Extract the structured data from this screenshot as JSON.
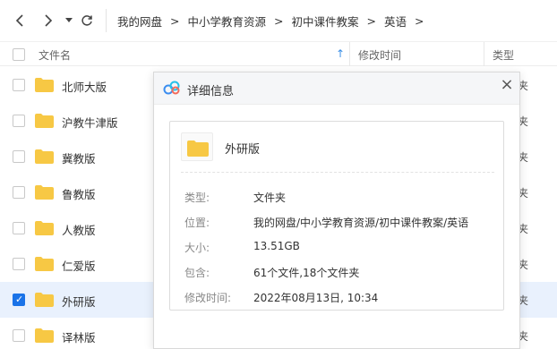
{
  "breadcrumb": [
    "我的网盘",
    "中小学教育资源",
    "初中课件教案",
    "英语"
  ],
  "breadcrumb_separator": ">",
  "columns": {
    "name": "文件名",
    "mtime": "修改时间",
    "type": "类型"
  },
  "rows": [
    {
      "name": "北师大版",
      "type_partial": "夹",
      "selected": false
    },
    {
      "name": "沪教牛津版",
      "type_partial": "夹",
      "selected": false
    },
    {
      "name": "冀教版",
      "type_partial": "夹",
      "selected": false
    },
    {
      "name": "鲁教版",
      "type_partial": "夹",
      "selected": false
    },
    {
      "name": "人教版",
      "type_partial": "夹",
      "selected": false
    },
    {
      "name": "仁爱版",
      "type_partial": "夹",
      "selected": false
    },
    {
      "name": "外研版",
      "type_partial": "夹",
      "selected": true
    },
    {
      "name": "译林版",
      "type_partial": "夹",
      "selected": false
    }
  ],
  "dialog": {
    "title": "详细信息",
    "folder_name": "外研版",
    "labels": {
      "type": "类型:",
      "location": "位置:",
      "size": "大小:",
      "contains": "包含:",
      "mtime": "修改时间:"
    },
    "values": {
      "type": "文件夹",
      "location": "我的网盘/中小学教育资源/初中课件教案/英语",
      "size": "13.51GB",
      "contains": "61个文件,18个文件夹",
      "mtime": "2022年08月13日, 10:34"
    }
  },
  "colors": {
    "folder": "#f7c844",
    "accent": "#1a73e8",
    "selected_row": "#e9f1fd"
  },
  "icons": {
    "back": "chevron-left-icon",
    "forward": "chevron-right-icon",
    "dropdown": "caret-down-icon",
    "refresh": "refresh-icon",
    "sort": "sort-up-icon",
    "close": "close-icon",
    "logo": "cloud-logo-icon",
    "folder": "folder-icon"
  }
}
